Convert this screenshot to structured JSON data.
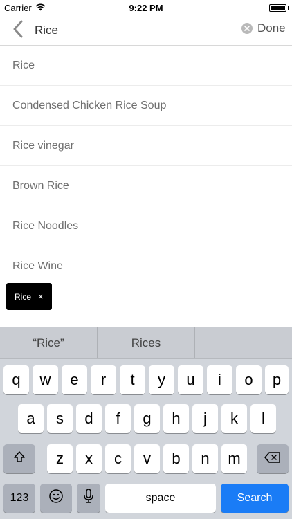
{
  "status_bar": {
    "carrier": "Carrier",
    "time": "9:22 PM"
  },
  "search": {
    "value": "Rice",
    "done_label": "Done"
  },
  "results": [
    "Rice",
    "Condensed Chicken Rice Soup",
    "Rice vinegar",
    "Brown Rice",
    "Rice Noodles",
    "Rice Wine"
  ],
  "chip": {
    "label": "Rice",
    "remove": "×"
  },
  "keyboard": {
    "predictions": [
      "“Rice”",
      "Rices",
      ""
    ],
    "row1": [
      "q",
      "w",
      "e",
      "r",
      "t",
      "y",
      "u",
      "i",
      "o",
      "p"
    ],
    "row2": [
      "a",
      "s",
      "d",
      "f",
      "g",
      "h",
      "j",
      "k",
      "l"
    ],
    "row3": [
      "z",
      "x",
      "c",
      "v",
      "b",
      "n",
      "m"
    ],
    "numbers_label": "123",
    "space_label": "space",
    "search_label": "Search"
  },
  "colors": {
    "search_key": "#1a7cf6",
    "keyboard_bg": "#d1d5db",
    "chip_bg": "#000000"
  }
}
